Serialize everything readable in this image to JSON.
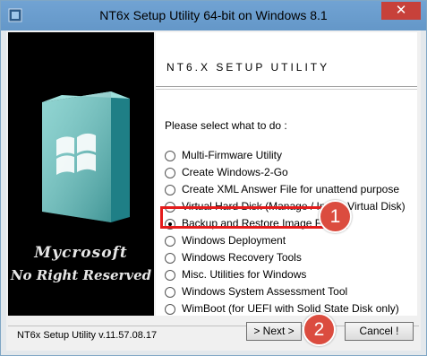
{
  "window": {
    "title": "NT6x Setup Utility 64-bit on Windows 8.1",
    "close_glyph": "✕"
  },
  "side": {
    "brand_line1": "Mycrosoft",
    "brand_line2": "No Right Reserved"
  },
  "content": {
    "header": "NT6.X SETUP UTILITY",
    "prompt": "Please select what to do :",
    "options": [
      {
        "label": "Multi-Firmware Utility",
        "checked": false
      },
      {
        "label": "Create Windows-2-Go",
        "checked": false
      },
      {
        "label": "Create XML Answer File for unattend purpose",
        "checked": false
      },
      {
        "label": "Virtual Hard Disk (Manage / Install Virtual Disk)",
        "checked": false
      },
      {
        "label": "Backup and Restore Image File",
        "checked": true
      },
      {
        "label": "Windows Deployment",
        "checked": false
      },
      {
        "label": "Windows Recovery Tools",
        "checked": false
      },
      {
        "label": "Misc. Utilities for Windows",
        "checked": false
      },
      {
        "label": "Windows System Assessment Tool",
        "checked": false
      },
      {
        "label": "WimBoot (for UEFI with Solid State Disk only)",
        "checked": false
      }
    ]
  },
  "annotations": {
    "badge1": "1",
    "badge2": "2",
    "color": "#db4c3f"
  },
  "footer": {
    "version": "NT6x Setup Utility v.11.57.08.17",
    "next_label": "> Next >",
    "cancel_label": "Cancel !"
  }
}
